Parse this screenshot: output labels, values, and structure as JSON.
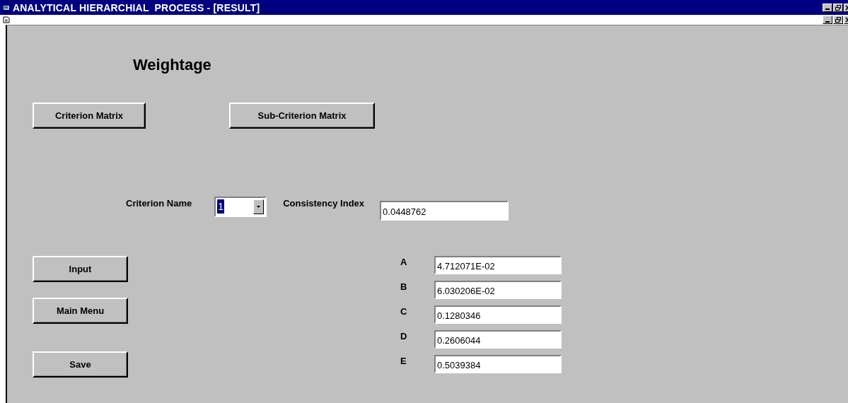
{
  "window": {
    "title": "ANALYTICAL HIERARCHIAL  PROCESS - [RESULT]"
  },
  "heading": "Weightage",
  "matrix_buttons": [
    "Criterion Matrix",
    "Sub-Criterion Matrix"
  ],
  "criterion": {
    "label": "Criterion Name",
    "value": "1",
    "value_selected": true
  },
  "consistency": {
    "label": "Consistency Index",
    "value": "0.0448762"
  },
  "weights": [
    {
      "label": "A",
      "value": "4.712071E-02"
    },
    {
      "label": "B",
      "value": "6.030206E-02"
    },
    {
      "label": "C",
      "value": "0.1280346"
    },
    {
      "label": "D",
      "value": "0.2606044"
    },
    {
      "label": "E",
      "value": "0.5039384"
    }
  ],
  "action_buttons": [
    "Input",
    "Main Menu",
    "Save"
  ]
}
